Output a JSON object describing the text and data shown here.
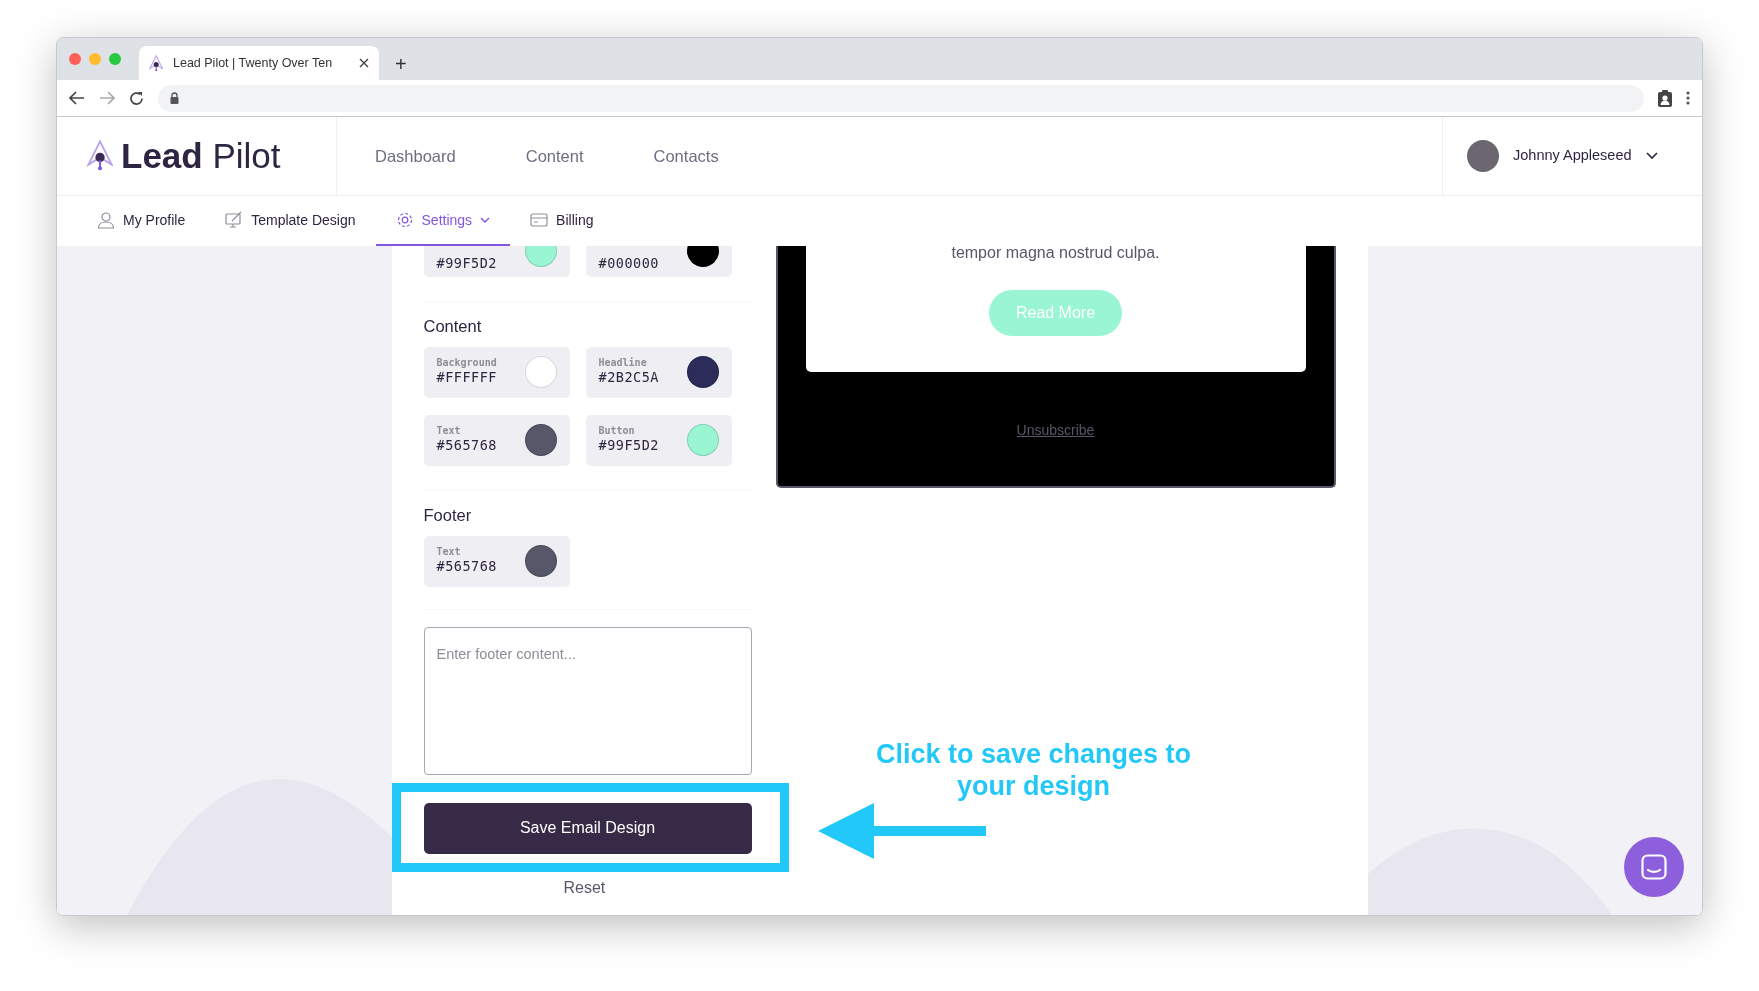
{
  "browser": {
    "tab_title": "Lead Pilot | Twenty Over Ten",
    "new_tab": "+"
  },
  "app": {
    "logo": {
      "bold": "Lead",
      "light": "Pilot"
    },
    "nav": [
      {
        "label": "Dashboard"
      },
      {
        "label": "Content"
      },
      {
        "label": "Contacts"
      }
    ],
    "user": {
      "name": "Johnny Appleseed"
    }
  },
  "subnav": [
    {
      "label": "My Profile",
      "kind": "profile",
      "selected": false,
      "dropdown": false
    },
    {
      "label": "Template Design",
      "kind": "design",
      "selected": false,
      "dropdown": false
    },
    {
      "label": "Settings",
      "kind": "settings",
      "selected": true,
      "dropdown": true
    },
    {
      "label": "Billing",
      "kind": "billing",
      "selected": false,
      "dropdown": false
    }
  ],
  "settings": {
    "partial_swatches": [
      {
        "value": "#99F5D2",
        "color": "#99f5d2"
      },
      {
        "value": "#000000",
        "color": "#000000"
      }
    ],
    "sections": [
      {
        "title": "Content",
        "swatches": [
          {
            "label": "Background",
            "value": "#FFFFFF",
            "color": "#ffffff"
          },
          {
            "label": "Headline",
            "value": "#2B2C5A",
            "color": "#2b2c5a"
          },
          {
            "label": "Text",
            "value": "#565768",
            "color": "#565768"
          },
          {
            "label": "Button",
            "value": "#99F5D2",
            "color": "#99f5d2"
          }
        ]
      },
      {
        "title": "Footer",
        "swatches": [
          {
            "label": "Text",
            "value": "#565768",
            "color": "#565768"
          }
        ]
      }
    ],
    "footer_field": {
      "placeholder": "Enter footer content..."
    },
    "save_button": "Save Email Design",
    "reset": "Reset"
  },
  "preview": {
    "body_text": "tempor magna nostrud culpa.",
    "button": "Read More",
    "unsubscribe": "Unsubscribe"
  },
  "annotation": {
    "text": "Click to save changes to your design"
  }
}
